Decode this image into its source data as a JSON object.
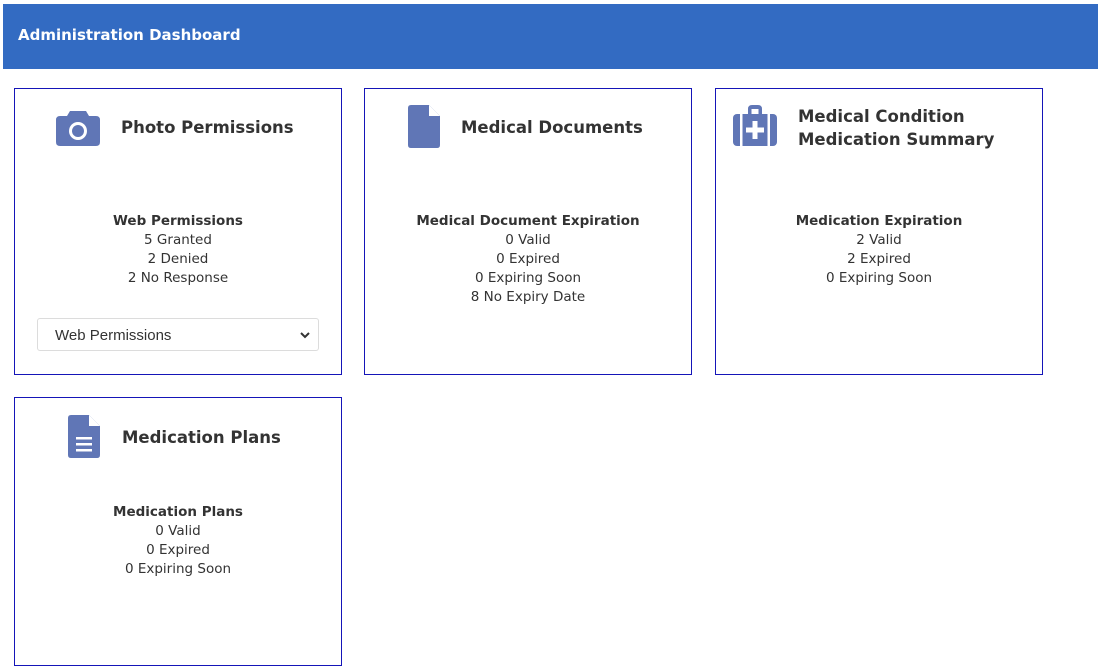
{
  "header": {
    "title": "Administration Dashboard",
    "background_color": "#336bc2"
  },
  "accent_icon_color": "#6076b6",
  "card_border_color": "#1515b8",
  "cards": [
    {
      "icon": "camera-icon",
      "title_lines": [
        "Photo Permissions"
      ],
      "heading": "Web Permissions",
      "lines": [
        "5 Granted",
        "2 Denied",
        "2 No Response"
      ],
      "select": {
        "selected": "Web Permissions"
      }
    },
    {
      "icon": "document-icon",
      "title_lines": [
        "Medical Documents"
      ],
      "heading": "Medical Document Expiration",
      "lines": [
        "0 Valid",
        "0 Expired",
        "0 Expiring Soon",
        "8 No Expiry Date"
      ]
    },
    {
      "icon": "medical-kit-icon",
      "title_lines": [
        "Medical Condition",
        "Medication Summary"
      ],
      "heading": "Medication Expiration",
      "lines": [
        "2 Valid",
        "2 Expired",
        "0 Expiring Soon"
      ]
    },
    {
      "icon": "document-text-icon",
      "title_lines": [
        "Medication Plans"
      ],
      "heading": "Medication Plans",
      "lines": [
        "0 Valid",
        "0 Expired",
        "0 Expiring Soon"
      ]
    }
  ]
}
